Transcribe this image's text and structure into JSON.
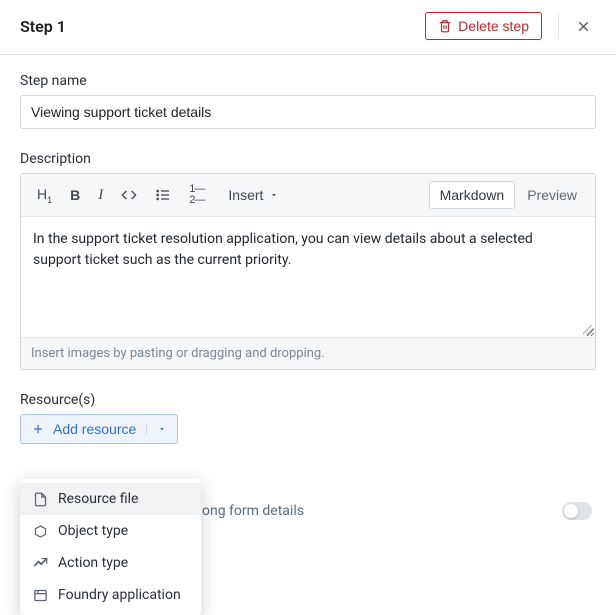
{
  "header": {
    "title": "Step 1",
    "delete_label": "Delete step"
  },
  "step_name": {
    "label": "Step name",
    "value": "Viewing support ticket details"
  },
  "description": {
    "label": "Description",
    "toolbar": {
      "insert_label": "Insert",
      "markdown_label": "Markdown",
      "preview_label": "Preview"
    },
    "content": "In the support ticket resolution application, you can view details about a selected support ticket such as the current priority.",
    "hint": "Insert images by pasting or dragging and dropping."
  },
  "resources": {
    "label": "Resource(s)",
    "add_label": "Add resource",
    "menu": {
      "resource_file": "Resource file",
      "object_type": "Object type",
      "action_type": "Action type",
      "foundry_application": "Foundry application"
    }
  },
  "switch": {
    "label": "ong form details",
    "value": false
  }
}
